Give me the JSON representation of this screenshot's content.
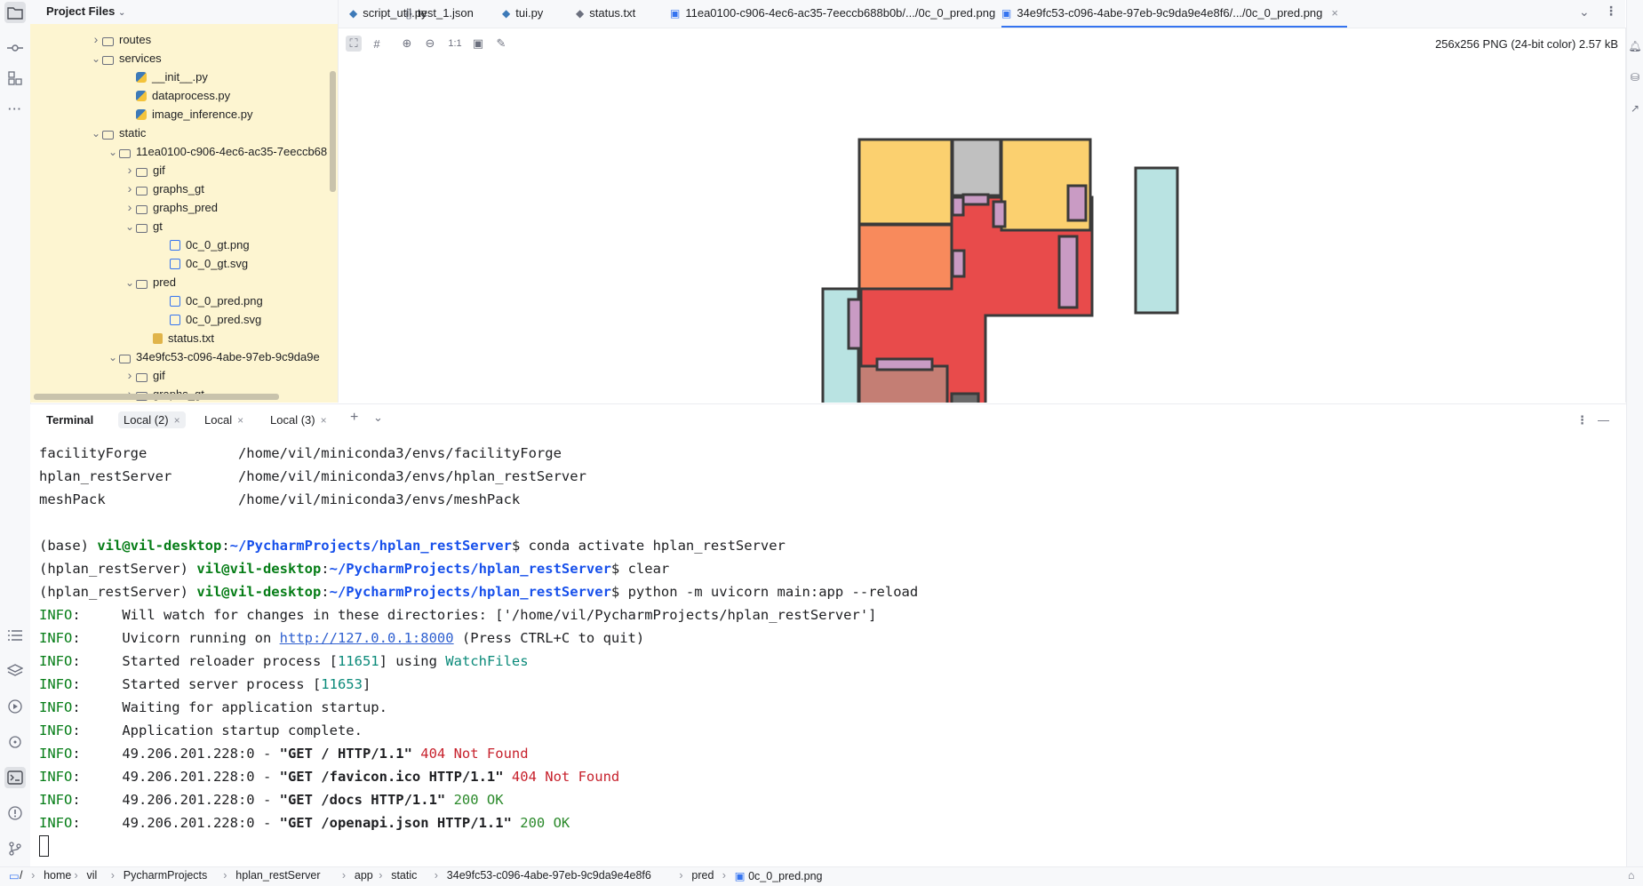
{
  "project": {
    "title": "Project Files",
    "tree": [
      {
        "label": "routes",
        "kind": "folder",
        "chevron": "right",
        "indent": 3
      },
      {
        "label": "services",
        "kind": "folder",
        "chevron": "down",
        "indent": 3
      },
      {
        "label": "__init__.py",
        "kind": "py",
        "chevron": "",
        "indent": 5
      },
      {
        "label": "dataprocess.py",
        "kind": "py",
        "chevron": "",
        "indent": 5
      },
      {
        "label": "image_inference.py",
        "kind": "py",
        "chevron": "",
        "indent": 5
      },
      {
        "label": "static",
        "kind": "folder",
        "chevron": "down",
        "indent": 3
      },
      {
        "label": "11ea0100-c906-4ec6-ac35-7eeccb68",
        "kind": "folder",
        "chevron": "down",
        "indent": 4
      },
      {
        "label": "gif",
        "kind": "folder",
        "chevron": "right",
        "indent": 5
      },
      {
        "label": "graphs_gt",
        "kind": "folder",
        "chevron": "right",
        "indent": 5
      },
      {
        "label": "graphs_pred",
        "kind": "folder",
        "chevron": "right",
        "indent": 5
      },
      {
        "label": "gt",
        "kind": "folder",
        "chevron": "down",
        "indent": 5
      },
      {
        "label": "0c_0_gt.png",
        "kind": "png",
        "chevron": "",
        "indent": 7
      },
      {
        "label": "0c_0_gt.svg",
        "kind": "png",
        "chevron": "",
        "indent": 7
      },
      {
        "label": "pred",
        "kind": "folder",
        "chevron": "down",
        "indent": 5
      },
      {
        "label": "0c_0_pred.png",
        "kind": "png",
        "chevron": "",
        "indent": 7
      },
      {
        "label": "0c_0_pred.svg",
        "kind": "png",
        "chevron": "",
        "indent": 7
      },
      {
        "label": "status.txt",
        "kind": "txt",
        "chevron": "",
        "indent": 6
      },
      {
        "label": "34e9fc53-c096-4abe-97eb-9c9da9e",
        "kind": "folder",
        "chevron": "down",
        "indent": 4
      },
      {
        "label": "gif",
        "kind": "folder",
        "chevron": "right",
        "indent": 5
      },
      {
        "label": "graphs_gt",
        "kind": "folder",
        "chevron": "right",
        "indent": 5
      }
    ]
  },
  "tabs": [
    {
      "label": "script_util.py",
      "icon": "python-file-icon",
      "glyph": "◆",
      "cls": "tab-py",
      "active": false
    },
    {
      "label": "test_1.json",
      "icon": "json-file-icon",
      "glyph": "{}",
      "cls": "tab-json",
      "active": false
    },
    {
      "label": "tui.py",
      "icon": "python-file-icon",
      "glyph": "◆",
      "cls": "tab-py",
      "active": false
    },
    {
      "label": "status.txt",
      "icon": "text-file-icon",
      "glyph": "◆",
      "cls": "tab-txt",
      "active": false
    },
    {
      "label": "11ea0100-c906-4ec6-ac35-7eeccb688b0b/.../0c_0_pred.png",
      "icon": "image-file-icon",
      "glyph": "▣",
      "cls": "tab-png",
      "active": false
    },
    {
      "label": "34e9fc53-c096-4abe-97eb-9c9da9e4e8f6/.../0c_0_pred.png",
      "icon": "image-file-icon",
      "glyph": "▣",
      "cls": "tab-png",
      "active": true
    }
  ],
  "image_viewer": {
    "info": "256x256 PNG (24-bit color) 2.57 kB",
    "zoom_actual_label": "1:1"
  },
  "terminal": {
    "title": "Terminal",
    "sessions": [
      "Local (2)",
      "Local",
      "Local (3)"
    ],
    "lines": [
      {
        "segs": [
          {
            "t": "facilityForge           /home/vil/miniconda3/envs/facilityForge",
            "c": ""
          }
        ]
      },
      {
        "segs": [
          {
            "t": "hplan_restServer        /home/vil/miniconda3/envs/hplan_restServer",
            "c": ""
          }
        ]
      },
      {
        "segs": [
          {
            "t": "meshPack                /home/vil/miniconda3/envs/meshPack",
            "c": ""
          }
        ]
      },
      {
        "segs": [
          {
            "t": "",
            "c": ""
          }
        ]
      },
      {
        "segs": [
          {
            "t": "(base) ",
            "c": ""
          },
          {
            "t": "vil@vil-desktop",
            "c": "greenb"
          },
          {
            "t": ":",
            "c": ""
          },
          {
            "t": "~/PycharmProjects/hplan_restServer",
            "c": "blueb"
          },
          {
            "t": "$ conda activate hplan_restServer",
            "c": ""
          }
        ]
      },
      {
        "segs": [
          {
            "t": "(hplan_restServer) ",
            "c": ""
          },
          {
            "t": "vil@vil-desktop",
            "c": "greenb"
          },
          {
            "t": ":",
            "c": ""
          },
          {
            "t": "~/PycharmProjects/hplan_restServer",
            "c": "blueb"
          },
          {
            "t": "$ clear",
            "c": ""
          }
        ]
      },
      {
        "segs": [
          {
            "t": "(hplan_restServer) ",
            "c": ""
          },
          {
            "t": "vil@vil-desktop",
            "c": "greenb"
          },
          {
            "t": ":",
            "c": ""
          },
          {
            "t": "~/PycharmProjects/hplan_restServer",
            "c": "blueb"
          },
          {
            "t": "$ python -m uvicorn main:app --reload",
            "c": ""
          }
        ]
      },
      {
        "segs": [
          {
            "t": "INFO",
            "c": "green"
          },
          {
            "t": ":     Will watch for changes in these directories: ['/home/vil/PycharmProjects/hplan_restServer']",
            "c": ""
          }
        ]
      },
      {
        "segs": [
          {
            "t": "INFO",
            "c": "green"
          },
          {
            "t": ":     Uvicorn running on ",
            "c": ""
          },
          {
            "t": "http://127.0.0.1:8000",
            "c": "link"
          },
          {
            "t": " (Press CTRL+C to quit)",
            "c": ""
          }
        ]
      },
      {
        "segs": [
          {
            "t": "INFO",
            "c": "green"
          },
          {
            "t": ":     Started reloader process [",
            "c": ""
          },
          {
            "t": "11651",
            "c": "teal"
          },
          {
            "t": "] using ",
            "c": ""
          },
          {
            "t": "WatchFiles",
            "c": "teal"
          }
        ]
      },
      {
        "segs": [
          {
            "t": "INFO",
            "c": "green"
          },
          {
            "t": ":     Started server process [",
            "c": ""
          },
          {
            "t": "11653",
            "c": "teal"
          },
          {
            "t": "]",
            "c": ""
          }
        ]
      },
      {
        "segs": [
          {
            "t": "INFO",
            "c": "green"
          },
          {
            "t": ":     Waiting for application startup.",
            "c": ""
          }
        ]
      },
      {
        "segs": [
          {
            "t": "INFO",
            "c": "green"
          },
          {
            "t": ":     Application startup complete.",
            "c": ""
          }
        ]
      },
      {
        "segs": [
          {
            "t": "INFO",
            "c": "green"
          },
          {
            "t": ":     49.206.201.228:0 - ",
            "c": ""
          },
          {
            "t": "\"GET / HTTP/1.1\"",
            "c": "bold"
          },
          {
            "t": " 404 Not Found",
            "c": "red"
          }
        ]
      },
      {
        "segs": [
          {
            "t": "INFO",
            "c": "green"
          },
          {
            "t": ":     49.206.201.228:0 - ",
            "c": ""
          },
          {
            "t": "\"GET /favicon.ico HTTP/1.1\"",
            "c": "bold"
          },
          {
            "t": " 404 Not Found",
            "c": "red"
          }
        ]
      },
      {
        "segs": [
          {
            "t": "INFO",
            "c": "green"
          },
          {
            "t": ":     49.206.201.228:0 - ",
            "c": ""
          },
          {
            "t": "\"GET /docs HTTP/1.1\"",
            "c": "bold"
          },
          {
            "t": " 200 OK",
            "c": "okgreen"
          }
        ]
      },
      {
        "segs": [
          {
            "t": "INFO",
            "c": "green"
          },
          {
            "t": ":     49.206.201.228:0 - ",
            "c": ""
          },
          {
            "t": "\"GET /openapi.json HTTP/1.1\"",
            "c": "bold"
          },
          {
            "t": " 200 OK",
            "c": "okgreen"
          }
        ]
      }
    ]
  },
  "breadcrumb": [
    "/",
    "home",
    "vil",
    "PycharmProjects",
    "hplan_restServer",
    "app",
    "static",
    "34e9fc53-c096-4abe-97eb-9c9da9e4e8f6",
    "pred",
    "0c_0_pred.png"
  ],
  "colors": {
    "accent": "#3574f0",
    "project_bg": "#fdf5d1",
    "room_living": "#e84b4b",
    "room_bed": "#fbd06f",
    "room_kitchen": "#f88a5c",
    "room_bath": "#c0c0c0",
    "room_balcony": "#b9e3e2",
    "door": "#c99bc4",
    "room_storage": "#c47e74"
  }
}
